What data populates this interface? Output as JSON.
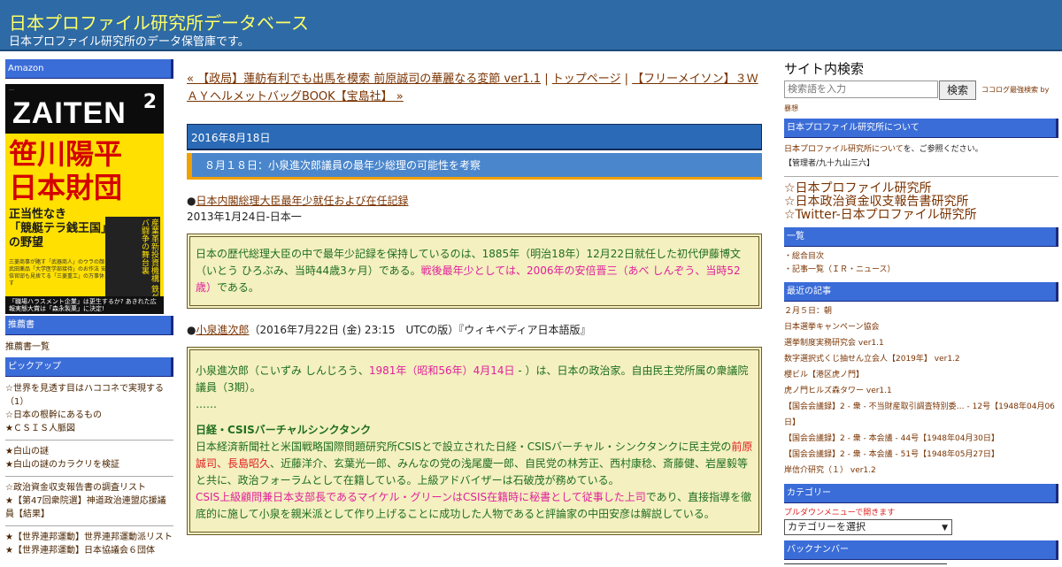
{
  "header": {
    "title": "日本プロファイル研究所データベース",
    "description": "日本プロファイル研究所のデータ保管庫です。"
  },
  "left": {
    "amazon_heading": "Amazon",
    "book": {
      "magazine": "ZAITEN",
      "month": "2",
      "headline1": "笹川陽平",
      "headline2": "日本財団",
      "sub1": "正当性なき",
      "sub2": "「競艇テラ銭王国」",
      "sub3": "の野望",
      "side": "産業革新投資機構 鉄ゲバ闘争の舞台裏",
      "lines": "三菱商事が賭す「武器商人」のウラの顔 武田薬品「大学医学部接待」のお作法 安倍官邸も見捨てる「三菱重工」の万事休す",
      "bottom": "「職場ハラスメント企業」は更生するか? あきれた広報実態大賞は「森永製菓」に決定!"
    },
    "recommend_heading": "推薦書",
    "recommend_link": "推薦書一覧",
    "pickup_heading": "ピックアップ",
    "pickup_group1": [
      "☆世界を見透す目はハココネで実現する（1）",
      "☆日本の根幹にあるもの",
      "★ＣＳＩＳ人脈図"
    ],
    "pickup_group2": [
      "★白山の謎",
      "★白山の謎のカラクリを検証"
    ],
    "pickup_group3": [
      "☆政治資金収支報告書の調査リスト",
      "★【第47回衆院選】神道政治連盟応援議員【結果】"
    ],
    "pickup_group4": [
      "★【世界連邦運動】世界連邦運動派リスト",
      "★【世界連邦運動】日本協議会６団体"
    ]
  },
  "main": {
    "nav_prev": "« 【政局】蓮舫有利でも出馬を模索 前原誠司の華麗なる変節 ver1.1",
    "nav_sep1": " | ",
    "nav_top": "トップページ",
    "nav_sep2": " | ",
    "nav_next": "【フリーメイソン】３ＷＡＹヘルメットバッグBOOK【宝島社】 »",
    "date": "2016年8月18日",
    "post_title": "８月１８日：小泉進次郎議員の最年少総理の可能性を考察",
    "bullet1_mark": "●",
    "bullet1_link": "日本内閣総理大臣最年少就任および在任記録",
    "bullet1_sub": "2013年1月24日-日本一",
    "box1_a": "日本の歴代総理大臣の中で最年少記録を保持しているのは、1885年（明治18年）12月22日就任した初代伊藤博文（いとう ひろぶみ、当時44歳3ヶ月）である。",
    "box1_b": "戦後最年少としては、2006年の安倍晋三（あべ しんぞう、当時52歳）",
    "box1_c": "である。",
    "bullet2_mark": "●",
    "bullet2_link": "小泉進次郎",
    "bullet2_rest": "（2016年7月22日 (金) 23:15　UTCの版）『ウィキペディア日本語版』",
    "box2_p1a": "小泉進次郎（こいずみ しんじろう、",
    "box2_p1b": "1981年（昭和56年）4月14日",
    "box2_p1c": " - ）は、日本の政治家。自由民主党所属の衆議院議員（3期）。",
    "box2_ellipsis": "……",
    "box2_heading": "日経・CSISバーチャルシンクタンク",
    "box2_p2a": "日本経済新聞社と米国戦略国際問題研究所CSISとで設立された日経・CSISバーチャル・シンクタンクに民主党の",
    "box2_p2b": "前原誠司、長島昭久",
    "box2_p2c": "、近藤洋介、玄葉光一郎、みんなの党の浅尾慶一郎、自民党の林芳正、西村康稔、斎藤健、岩屋毅等と共に、政治フォーラムとして在籍している。上級アドバイザーは石破茂が務めている。",
    "box2_p3a": "CSIS上級顧問兼日本支部長であるマイケル・グリーンはCSIS在籍時に秘書として従事した上司",
    "box2_p3b": "であり、直接指導を徹底的に施して小泉を親米派として作り上げることに成功した人物であると評論家の中田安彦は解説している。"
  },
  "right": {
    "search_label": "サイト内検索",
    "search_placeholder": "検索語を入力",
    "search_button": "検索",
    "cocolog": "ココログ最強検索 by",
    "thoughts": "暴想",
    "about_heading": "日本プロファイル研究所について",
    "about_link": "日本プロファイル研究所について",
    "about_text": "を、ご参照ください。",
    "admin": "【管理者/九十九山三六】",
    "big_links": [
      "☆日本プロファイル研究所",
      "☆日本政治資金収支報告書研究所",
      "☆Twitter-日本プロファイル研究所"
    ],
    "list_heading": "一覧",
    "list_items": [
      "・総合目次",
      "・記事一覧（ＩＲ・ニュース）"
    ],
    "recent_heading": "最近の記事",
    "recent_items": [
      "２月５日：朝",
      "日本選挙キャンペーン協会",
      "選挙制度実務研究会 ver1.1",
      "数字選択式くじ抽せん立会人【2019年】 ver1.2",
      "櫻ビル【港区虎ノ門】",
      "虎ノ門ヒルズ森タワー ver1.1",
      "【国会会議録】2 - 衆 - 不当財産取引調査特別委… - 12号【1948年04月06日】",
      "【国会会議録】2 - 衆 - 本会議 - 44号【1948年04月30日】",
      "【国会会議録】2 - 衆 - 本会議 - 51号【1948年05月27日】",
      "岸信介研究（１） ver1.2"
    ],
    "category_heading": "カテゴリー",
    "category_note": "プルダウンメニューで開きます",
    "category_select": "カテゴリーを選択",
    "backnumber_heading": "バックナンバー"
  }
}
